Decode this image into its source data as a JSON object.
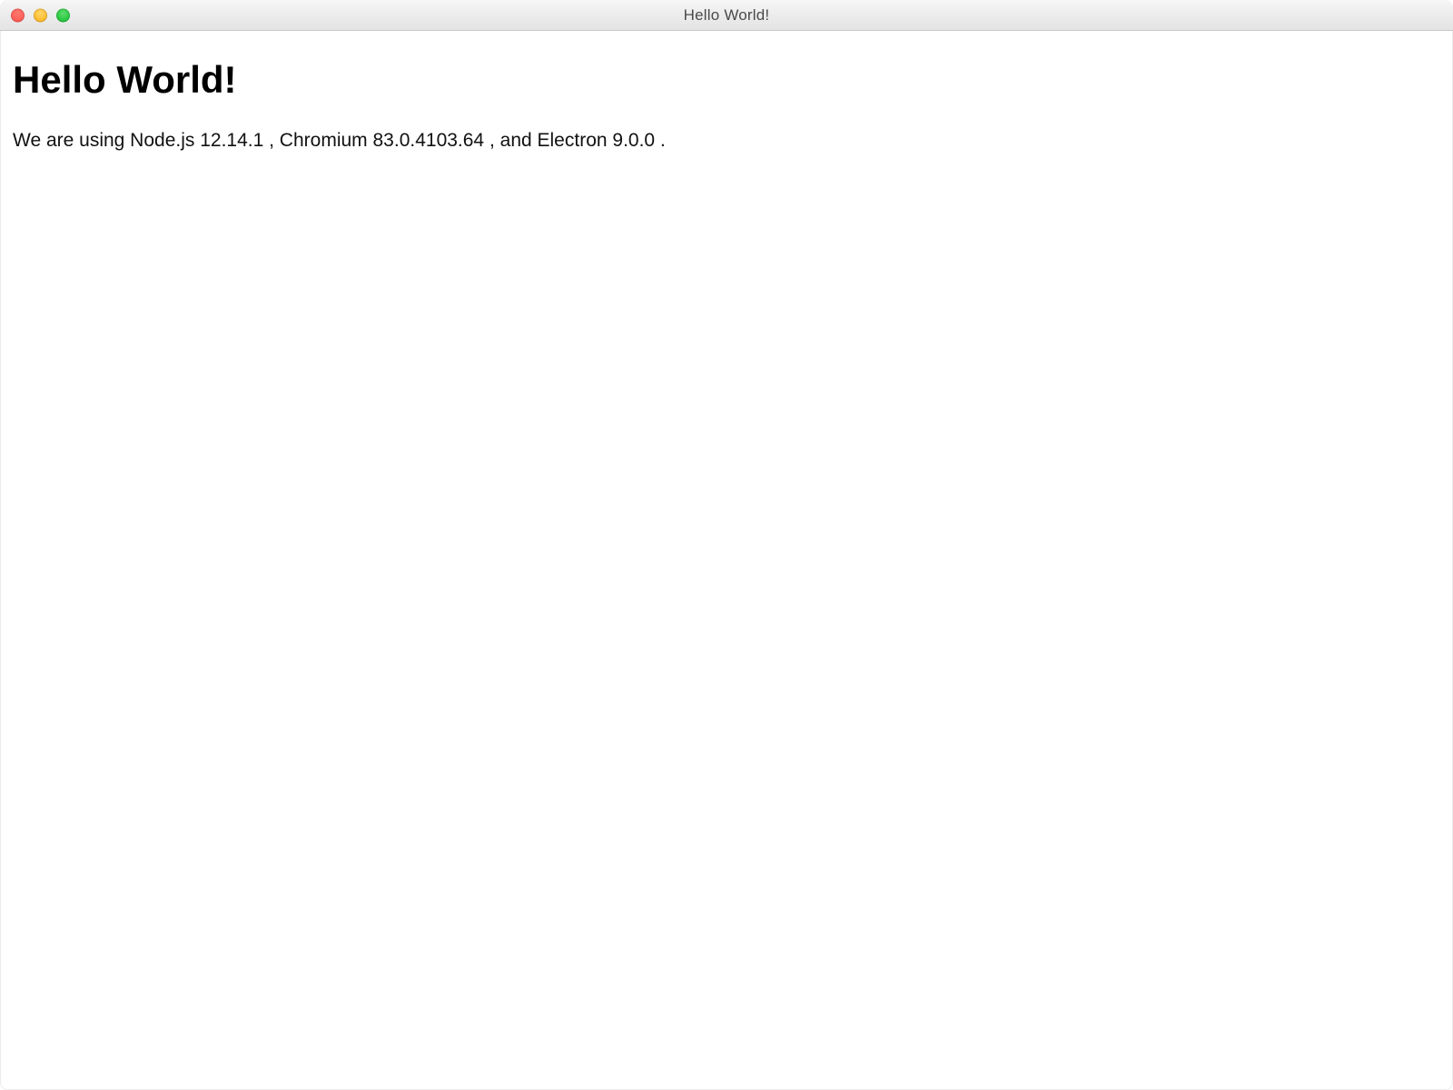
{
  "window": {
    "title": "Hello World!"
  },
  "content": {
    "heading": "Hello World!",
    "body_prefix": "We are using Node.js ",
    "node_version": "12.14.1",
    "body_mid1": ", Chromium ",
    "chromium_version": "83.0.4103.64",
    "body_mid2": ", and Electron ",
    "electron_version": "9.0.0",
    "body_suffix": "."
  }
}
